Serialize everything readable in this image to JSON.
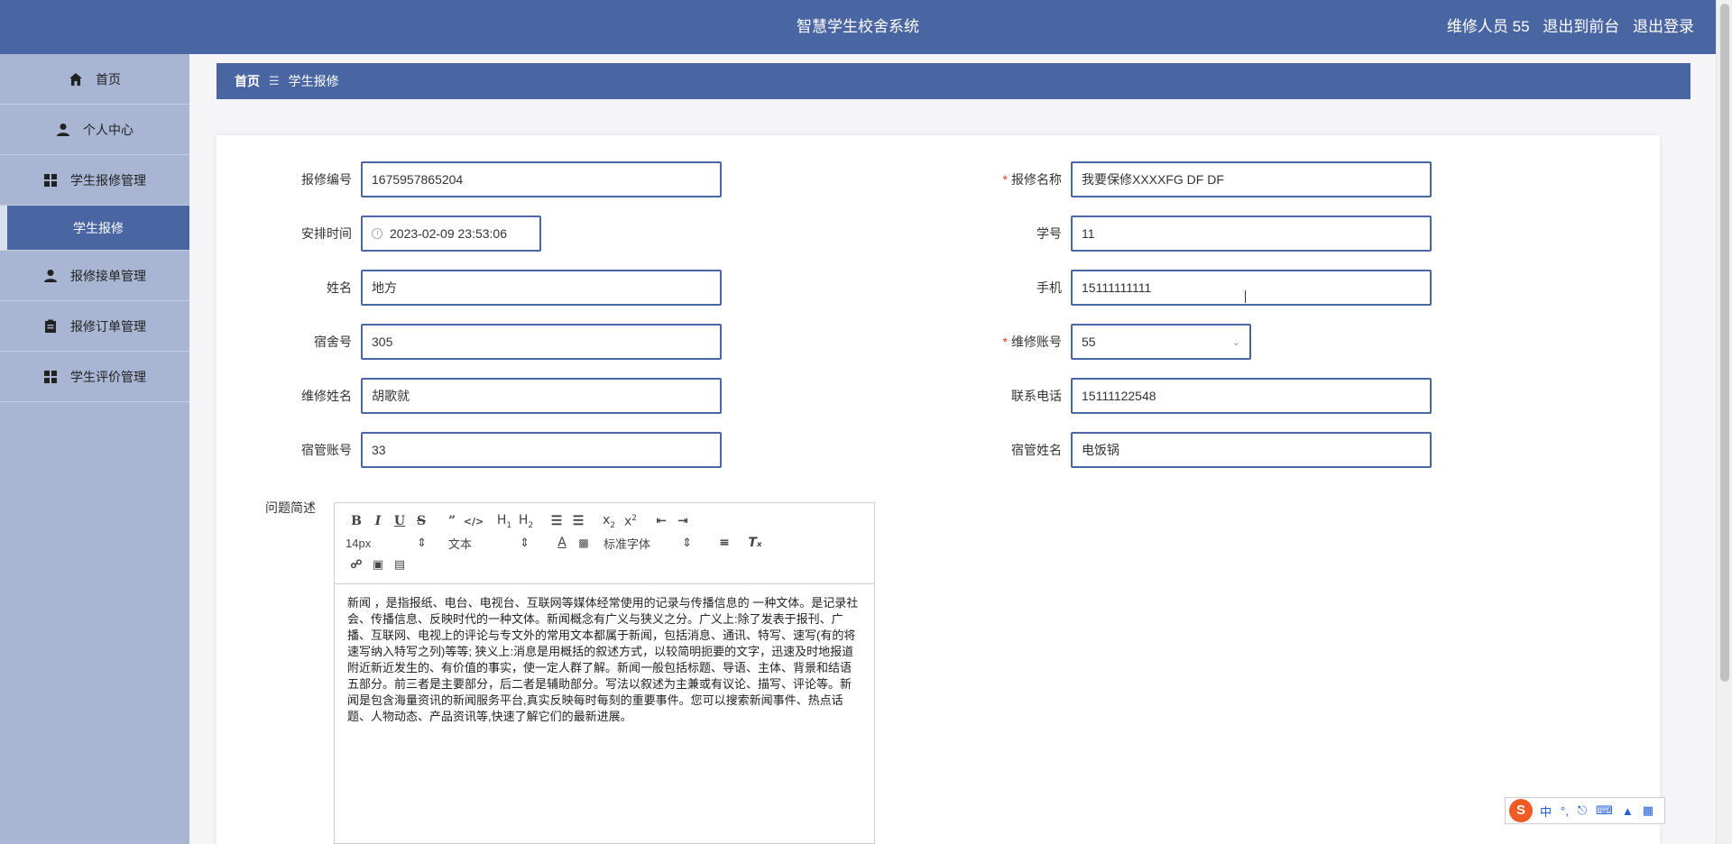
{
  "header": {
    "title": "智慧学生校舍系统",
    "user": "维修人员 55",
    "to_front": "退出到前台",
    "logout": "退出登录",
    "color": "#4a66a2"
  },
  "sidebar": {
    "items": [
      {
        "label": "首页",
        "icon": "home-icon"
      },
      {
        "label": "个人中心",
        "icon": "user-icon"
      },
      {
        "label": "学生报修管理",
        "icon": "grid-icon"
      },
      {
        "label": "学生报修",
        "icon": ""
      },
      {
        "label": "报修接单管理",
        "icon": "user-icon"
      },
      {
        "label": "报修订单管理",
        "icon": "clipboard-icon"
      },
      {
        "label": "学生评价管理",
        "icon": "grid-icon"
      }
    ]
  },
  "breadcrumb": {
    "home": "首页",
    "separator": "☰",
    "current": "学生报修"
  },
  "form": {
    "repair_no": {
      "label": "报修编号",
      "value": "1675957865204"
    },
    "repair_name": {
      "label": "报修名称",
      "value": "我要保修XXXXFG DF DF"
    },
    "schedule_time": {
      "label": "安排时间",
      "value": "2023-02-09 23:53:06"
    },
    "student_no": {
      "label": "学号",
      "value": "11"
    },
    "name": {
      "label": "姓名",
      "value": "地方"
    },
    "phone": {
      "label": "手机",
      "value": "15111111111"
    },
    "dorm_no": {
      "label": "宿舍号",
      "value": "305"
    },
    "repair_account": {
      "label": "维修账号",
      "value": "55"
    },
    "repair_person": {
      "label": "维修姓名",
      "value": "胡歌就"
    },
    "contact_phone": {
      "label": "联系电话",
      "value": "15111122548"
    },
    "dorm_admin_account": {
      "label": "宿管账号",
      "value": "33"
    },
    "dorm_admin_name": {
      "label": "宿管姓名",
      "value": "电饭锅"
    },
    "problem": {
      "label": "问题简述"
    }
  },
  "editor": {
    "font_size": "14px",
    "block_type": "文本",
    "font_family": "标准字体",
    "content": "新闻 ，是指报纸、电台、电视台、互联网等媒体经常使用的记录与传播信息的 一种文体。是记录社会、传播信息、反映时代的一种文体。新闻概念有广义与狭义之分。广义上:除了发表于报刊、广播、互联网、电视上的评论与专文外的常用文本都属于新闻，包括消息、通讯、特写、速写(有的将速写纳入特写之列)等等; 狭义上:消息是用概括的叙述方式，以较简明扼要的文字，迅速及时地报道附近新近发生的、有价值的事实，使一定人群了解。新闻一般包括标题、导语、主体、背景和结语五部分。前三者是主要部分，后二者是辅助部分。写法以叙述为主兼或有议论、描写、评论等。新闻是包含海量资讯的新闻服务平台,真实反映每时每刻的重要事件。您可以搜索新闻事件、热点话题、人物动态、产品资讯等,快速了解它们的最新进展。"
  },
  "ime": {
    "logo": "S",
    "lang": "中",
    "punct": "°,"
  }
}
